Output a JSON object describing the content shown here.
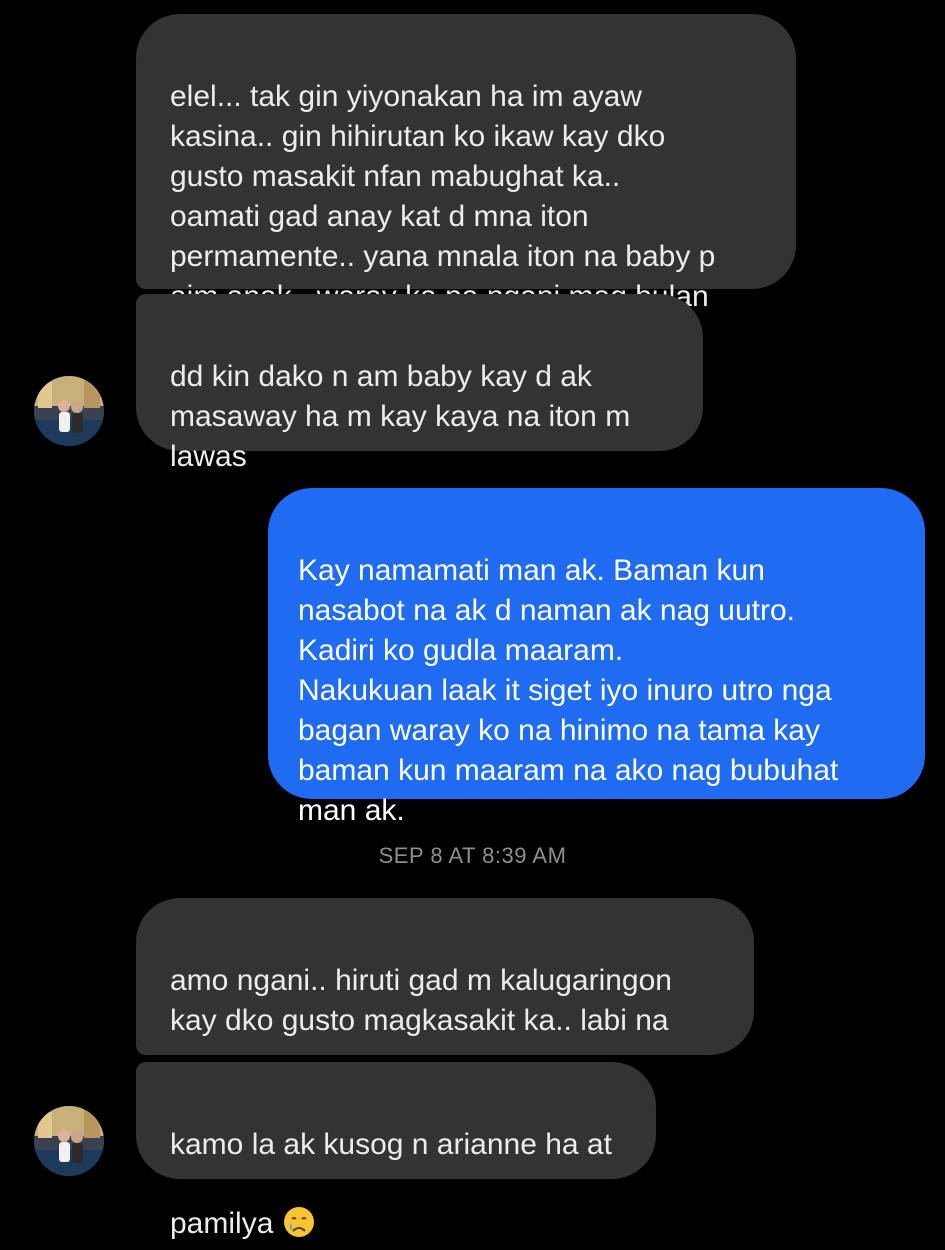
{
  "conversation": {
    "messages": [
      {
        "id": "m1",
        "direction": "incoming",
        "text": "elel... tak gin yiyonakan ha im ayaw\nkasina.. gin hihirutan ko ikaw kay dko\ngusto masakit nfan mabughat ka..\noamati gad anay kat d mna iton\npermamente.. yana mnala iton na baby p\naim anak.. waray ka pa ngani mag bulan"
      },
      {
        "id": "m2",
        "direction": "incoming",
        "text": "dd kin dako n am baby kay d ak\nmasaway ha m kay kaya na iton m\nlawas"
      },
      {
        "id": "m3",
        "direction": "outgoing",
        "text": "Kay namamati man ak. Baman kun\nnasabot na ak d naman ak nag uutro.\nKadiri ko gudla maaram.\nNakukuan laak it siget iyo inuro utro nga\nbagan waray ko na hinimo na tama kay\nbaman kun maaram na ako nag bubuhat\nman ak."
      },
      {
        "id": "m4",
        "direction": "incoming",
        "text": "amo ngani.. hiruti gad m kalugaringon\nkay dko gusto magkasakit ka.. labi na\nkon mabughat ka.. ",
        "emoji": "crying-face"
      },
      {
        "id": "m5",
        "direction": "incoming",
        "text": "kamo la ak kusog n arianne ha at\npamilya ",
        "emoji": "crying-face"
      }
    ],
    "timestamp": "SEP 8 AT 8:39 AM"
  },
  "colors": {
    "background": "#000000",
    "incoming_bubble": "#333333",
    "outgoing_bubble": "#1f6bf2",
    "timestamp_text": "#8e8e8e"
  },
  "icons": {
    "avatar": "contact-avatar-photo",
    "emoji": "crying-face-emoji"
  }
}
